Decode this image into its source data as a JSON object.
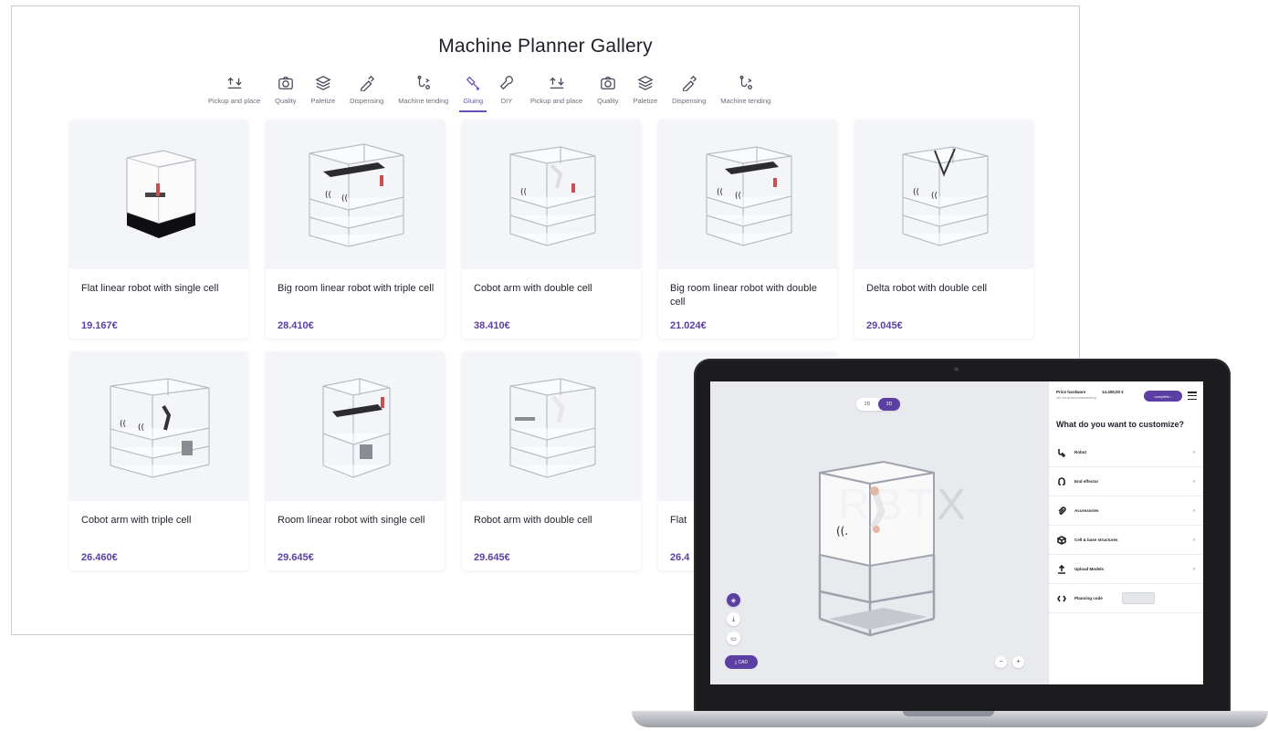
{
  "gallery": {
    "title": "Machine Planner Gallery",
    "tabs": [
      {
        "label": "Pickup and place",
        "icon": "upload-download-icon"
      },
      {
        "label": "Quality",
        "icon": "camera-icon"
      },
      {
        "label": "Paletize",
        "icon": "layers-icon"
      },
      {
        "label": "Dispensing",
        "icon": "dropper-icon"
      },
      {
        "label": "Machine tending",
        "icon": "robot-arm-icon"
      },
      {
        "label": "Gluing",
        "icon": "glue-icon",
        "active": true
      },
      {
        "label": "DIY",
        "icon": "wrench-icon"
      },
      {
        "label": "Pickup and place",
        "icon": "upload-download-icon"
      },
      {
        "label": "Quality",
        "icon": "camera-icon"
      },
      {
        "label": "Paletize",
        "icon": "layers-icon"
      },
      {
        "label": "Dispensing",
        "icon": "dropper-icon"
      },
      {
        "label": "Machine tending",
        "icon": "robot-arm-icon"
      }
    ],
    "cards": [
      {
        "name": "Flat linear robot with single cell",
        "price": "19.167€"
      },
      {
        "name": "Big room linear robot with triple cell",
        "price": "28.410€"
      },
      {
        "name": "Cobot arm with double cell",
        "price": "38.410€"
      },
      {
        "name": "Big room linear robot with double cell",
        "price": "21.024€"
      },
      {
        "name": "Delta robot with double cell",
        "price": "29.045€"
      },
      {
        "name": "Cobot arm with triple cell",
        "price": "26.460€"
      },
      {
        "name": "Room linear robot with single cell",
        "price": "29.645€"
      },
      {
        "name": "Robot arm with double cell",
        "price": "29.645€"
      },
      {
        "name": "Flat",
        "price": "26.4"
      }
    ]
  },
  "configurator": {
    "toggle": {
      "left": "2D",
      "right": "3D"
    },
    "watermark": "RBTX",
    "cad_label": "CAD",
    "price_label": "Price hardware",
    "price_value": "14.408,00 €",
    "price_sub": "incl. set-up and commissioning",
    "complete_label": "complete",
    "heading": "What do you want to customize?",
    "options": [
      {
        "label": "Robot",
        "icon": "robot-arm-icon"
      },
      {
        "label": "End effector",
        "icon": "gripper-icon"
      },
      {
        "label": "Accessories",
        "icon": "paperclip-icon"
      },
      {
        "label": "Cell & base structures",
        "icon": "cube-icon"
      },
      {
        "label": "Upload Models",
        "icon": "upload-icon"
      },
      {
        "label": "Planning code",
        "icon": "code-icon"
      }
    ]
  },
  "colors": {
    "accent": "#5b3fa3",
    "price": "#5b3fa3"
  }
}
